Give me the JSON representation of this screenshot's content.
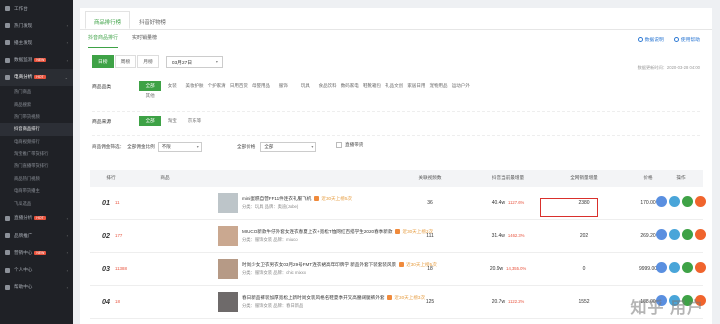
{
  "sidebar": {
    "items": [
      {
        "label": "工作台",
        "arrow": ""
      },
      {
        "label": "热门发现",
        "arrow": "›"
      },
      {
        "label": "播主发现",
        "arrow": "›"
      },
      {
        "label": "数据监测",
        "hot": "NEW",
        "arrow": "›"
      },
      {
        "label": "电商分析",
        "hot": "HOT",
        "arrow": "⌄",
        "open": true
      }
    ],
    "subs": [
      "热门商品",
      "商品搜索",
      "热门带货视频",
      "抖音商品排行",
      "电商视频排行",
      "淘宝推广带货排行",
      "热门直播带货排行",
      "商品热门视频",
      "电商带货播主",
      "飞瓜选品"
    ],
    "active_sub": 3,
    "items2": [
      {
        "label": "直播分析",
        "hot": "HOT",
        "arrow": "›"
      },
      {
        "label": "品牌推广",
        "arrow": "›"
      },
      {
        "label": "营销中心",
        "hot": "NEW",
        "arrow": "›"
      },
      {
        "label": "个人中心",
        "arrow": "›"
      },
      {
        "label": "帮助中心",
        "arrow": "›"
      }
    ]
  },
  "tabs": [
    "商品排行榜",
    "抖音好物榜"
  ],
  "subtabs": [
    "抖音商品排行",
    "实时销量榜"
  ],
  "toplinks": [
    "数据说明",
    "使用帮助"
  ],
  "period": {
    "options": [
      "日榜",
      "周榜",
      "月榜"
    ],
    "selected": "日榜",
    "date": "03月27日"
  },
  "update_time": "数据更新时间：2020-03-28 04:00",
  "filters": {
    "category_label": "商品品类",
    "categories": [
      "全部",
      "女装",
      "美妆护肤",
      "个护家清",
      "日用百货",
      "母婴用品",
      "服饰",
      "玩具",
      "食品饮料",
      "数码家电",
      "鞋靴箱包",
      "礼品文创",
      "家居日用",
      "宠物用品",
      "运动户外"
    ],
    "categories_row2": [
      "其他"
    ],
    "source_label": "商品来源",
    "sources": [
      "全部",
      "淘宝",
      "京东等"
    ],
    "price_label": "商品佣金筛选：",
    "price_sel_label": "全部佣金比例",
    "price_sel_value": "不限",
    "sales_label": "全部价格",
    "sales_sel_value": "全部",
    "check_label": "直播带货"
  },
  "columns": [
    "排行",
    "商品",
    "关联视频数",
    "抖音当前最增量",
    "全网销量增量",
    "价格",
    "操作"
  ],
  "rows": [
    {
      "rank": "01",
      "change": "11",
      "title": "mini蛋糕自营FF11件连衣礼服飞机",
      "sub": "分类：玩具 品牌：奥迪(Jobe)",
      "tag": "近30天上榜5次",
      "videos": "36",
      "incr": "40.4w",
      "incr_pct": "1127.6%",
      "total": "2380",
      "price": "170.00"
    },
    {
      "rank": "02",
      "change": "177",
      "title": "MIUCO新款牛仔外套女连衣春夏上衣+宽松T恤网红百搭学生2020春季新款",
      "sub": "分类：服饰女装 品牌：miuco",
      "tag": "近30天上榜2次",
      "videos": "111",
      "incr": "31.4w",
      "incr_pct": "1462.3%",
      "total": "202",
      "price": "269.20"
    },
    {
      "rank": "03",
      "change": "11388",
      "title": "时尚少女卫衣男衣女03月29号FMT连衣裙高年印牌学 新品外套下装套装风景",
      "sub": "分类：服饰女装 品牌：chic mixxx",
      "tag": "近30天上榜5次",
      "videos": "18",
      "incr": "20.9w",
      "incr_pct": "14,355.0%",
      "total": "0",
      "price": "9999.00"
    },
    {
      "rank": "04",
      "change": "18",
      "title": "春日新品裤装加厚宽松上新时尚女装风格名鞋夏季开叉高腰阔腿裤外套",
      "sub": "分类：服饰女装 品牌：春日新品",
      "tag": "近30天上榜3次",
      "videos": "125",
      "incr": "20.7w",
      "incr_pct": "1122.2%",
      "total": "1552",
      "price": "188.00"
    }
  ],
  "op_colors": [
    "#5a8fe0",
    "#49a5d9",
    "#3ea246",
    "#f0642d"
  ],
  "watermark": "知乎 用户"
}
